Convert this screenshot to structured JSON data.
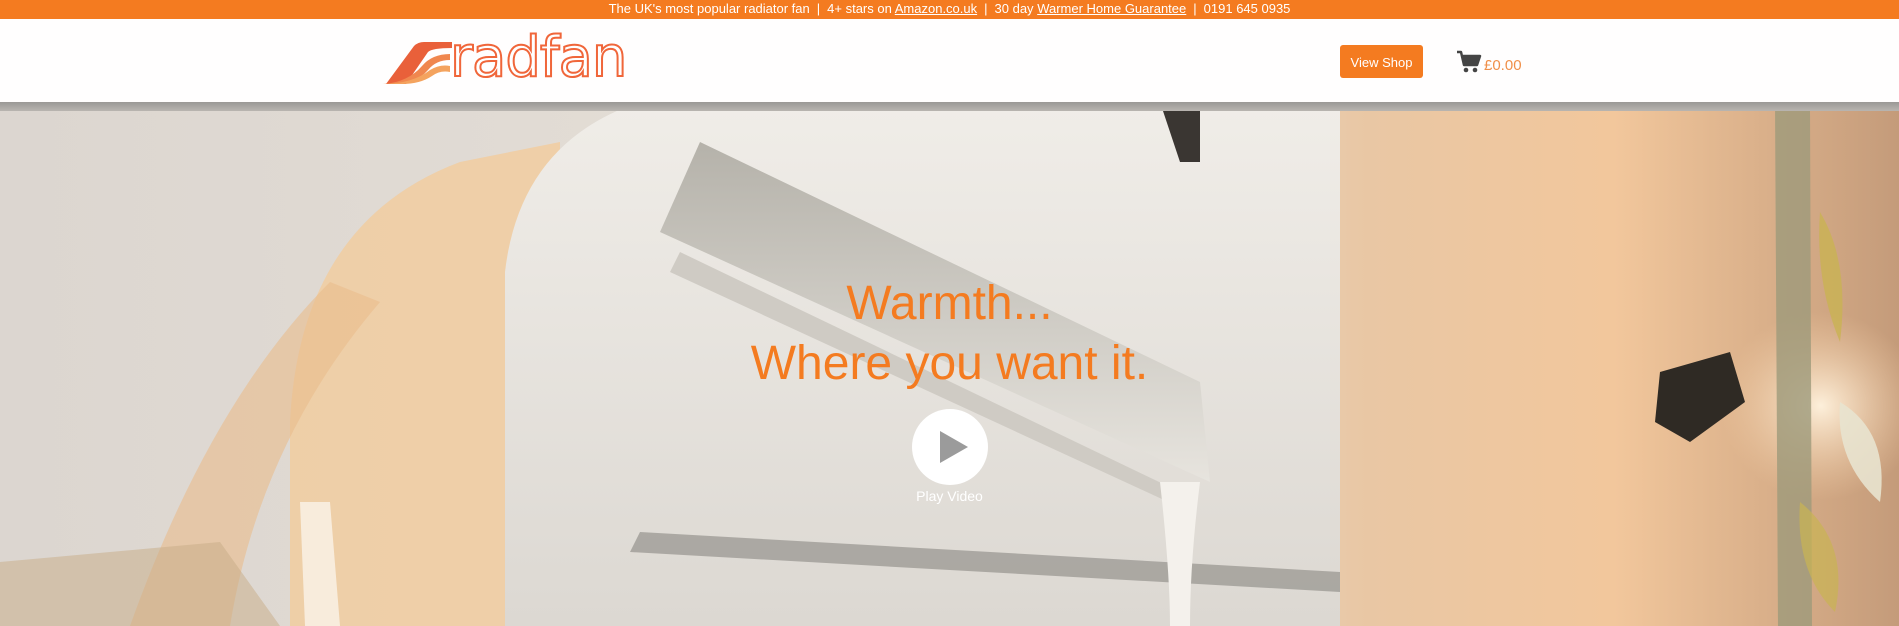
{
  "topbar": {
    "text_1": "The UK's most popular radiator fan",
    "separator": "|",
    "text_2_prefix": "4+ stars on",
    "amazon_link": "Amazon.co.uk",
    "text_3_prefix": "30 day",
    "guarantee_link": "Warmer Home Guarantee",
    "phone": "0191 645 0935"
  },
  "header": {
    "logo_text": "radfan",
    "shop_button": "View Shop",
    "cart_amount": "£0.00",
    "cart_icon": "shopping-cart-icon"
  },
  "hero": {
    "title_line_1": "Warmth...",
    "title_line_2": "Where you want it.",
    "play_label": "Play Video",
    "play_icon": "play-icon"
  },
  "colors": {
    "brand_orange": "#f47b20",
    "logo_coral": "#f0663a",
    "white": "#ffffff"
  }
}
